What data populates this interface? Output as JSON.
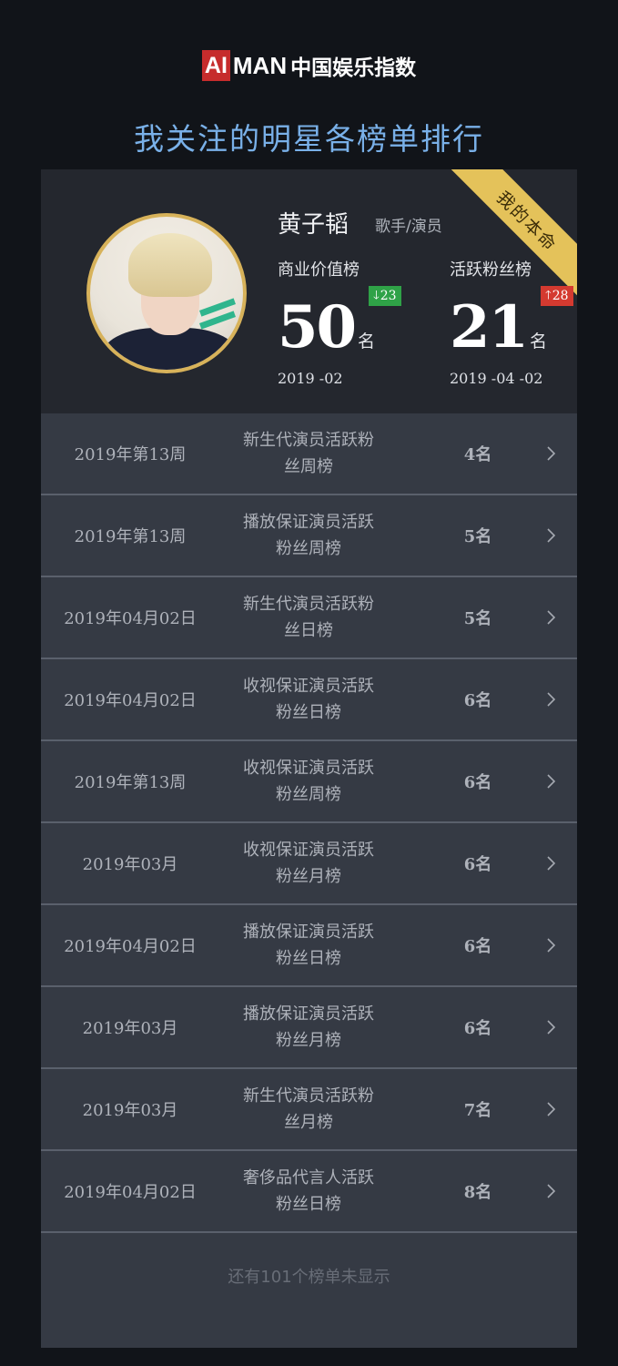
{
  "logo": {
    "ai": "AI",
    "man": "MAN",
    "cn": "中国娱乐指数"
  },
  "page_title": "我关注的明星各榜单排行",
  "profile": {
    "ribbon": "我的本命",
    "name": "黄子韬",
    "role": "歌手/演员",
    "avatar_icon": "portrait-photo",
    "blocks": [
      {
        "label": "商业价值榜",
        "rank": "50",
        "suffix": "名",
        "change": "23",
        "direction": "down",
        "date": "2019 -02"
      },
      {
        "label": "活跃粉丝榜",
        "rank": "21",
        "suffix": "名",
        "change": "28",
        "direction": "up",
        "date": "2019 -04 -02"
      }
    ]
  },
  "rankings": [
    {
      "period": "2019年第13周",
      "name": "新生代演员活跃粉丝周榜",
      "rank": "4名"
    },
    {
      "period": "2019年第13周",
      "name": "播放保证演员活跃粉丝周榜",
      "rank": "5名"
    },
    {
      "period": "2019年04月02日",
      "name": "新生代演员活跃粉丝日榜",
      "rank": "5名"
    },
    {
      "period": "2019年04月02日",
      "name": "收视保证演员活跃粉丝日榜",
      "rank": "6名"
    },
    {
      "period": "2019年第13周",
      "name": "收视保证演员活跃粉丝周榜",
      "rank": "6名"
    },
    {
      "period": "2019年03月",
      "name": "收视保证演员活跃粉丝月榜",
      "rank": "6名"
    },
    {
      "period": "2019年04月02日",
      "name": "播放保证演员活跃粉丝日榜",
      "rank": "6名"
    },
    {
      "period": "2019年03月",
      "name": "播放保证演员活跃粉丝月榜",
      "rank": "6名"
    },
    {
      "period": "2019年03月",
      "name": "新生代演员活跃粉丝月榜",
      "rank": "7名"
    },
    {
      "period": "2019年04月02日",
      "name": "奢侈品代言人活跃粉丝日榜",
      "rank": "8名"
    }
  ],
  "footer_note": "还有101个榜单未显示",
  "colors": {
    "background": "#111419",
    "title": "#79b0e8",
    "ribbon": "#e4c25a",
    "avatar_border": "#d7b25a",
    "badge_down": "#2fa247",
    "badge_up": "#d43a30",
    "logo_ai": "#c62c2c"
  }
}
